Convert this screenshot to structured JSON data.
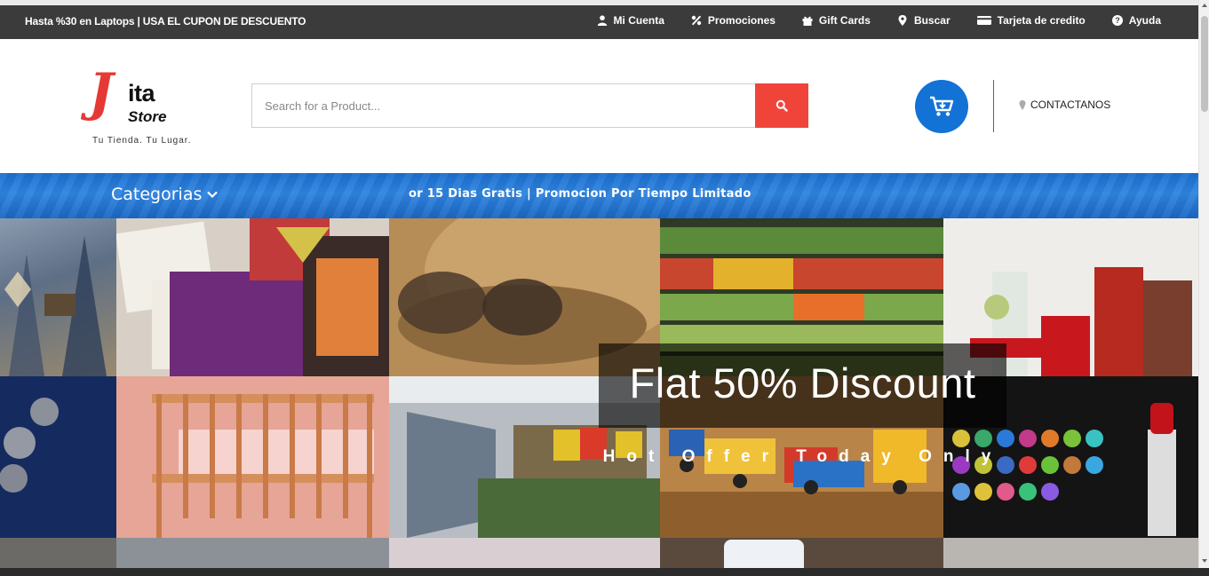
{
  "topbar": {
    "promo": "Hasta %30 en Laptops | USA EL CUPON DE DESCUENTO",
    "links": [
      {
        "label": "Mi Cuenta",
        "icon": "user-icon"
      },
      {
        "label": "Promociones",
        "icon": "percent-icon"
      },
      {
        "label": "Gift Cards",
        "icon": "gift-icon"
      },
      {
        "label": "Buscar",
        "icon": "map-marker-icon"
      },
      {
        "label": "Tarjeta de credito",
        "icon": "credit-card-icon"
      },
      {
        "label": "Ayuda",
        "icon": "help-icon"
      }
    ]
  },
  "logo": {
    "letter": "J",
    "word": "ita",
    "sub": "Store",
    "tagline": "Tu Tienda. Tu Lugar."
  },
  "search": {
    "placeholder": "Search for a Product...",
    "icon": "search-icon"
  },
  "header": {
    "cart_icon": "cart-icon",
    "contact_label": "CONTACTANOS",
    "contact_icon": "map-marker-icon"
  },
  "nav": {
    "categories_label": "Categorias",
    "marquee_text": "or 15 Dias Gratis | Promocion Por Tiempo Limitado"
  },
  "hero": {
    "title": "Flat 50% Discount",
    "subtitle": "Hot Offer Today Only"
  },
  "colors": {
    "topbar": "#3b3b3b",
    "accent_red": "#f0443b",
    "brand_blue": "#1272d6",
    "logo_red": "#e53935"
  }
}
